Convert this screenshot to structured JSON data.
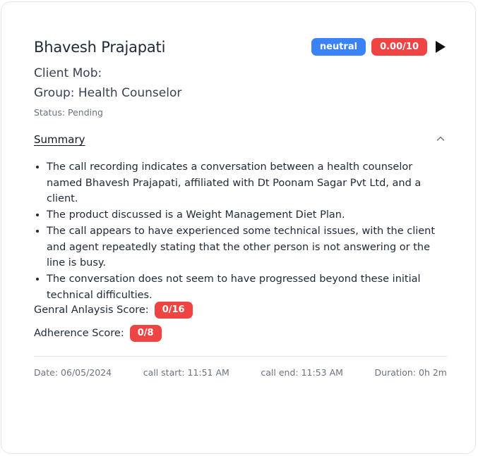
{
  "card": {
    "name": "Bhavesh Prajapati",
    "sentiment_badge": "neutral",
    "score_badge": "0.00/10",
    "play_icon": "play-icon",
    "client_mob": "Client Mob:",
    "group": "Group: Health Counselor",
    "status": "Status: Pending"
  },
  "summary": {
    "title": "Summary",
    "chevron_icon": "chevron-up-icon",
    "points": [
      "The call recording indicates a conversation between a health counselor named Bhavesh Prajapati, affiliated with Dt Poonam Sagar Pvt Ltd, and a client.",
      "The product discussed is a Weight Management Diet Plan.",
      "The call appears to have experienced some technical issues, with the client and agent repeatedly stating that the other person is not answering or the line is busy.",
      "The conversation does not seem to have progressed beyond these initial technical difficulties."
    ]
  },
  "scores": {
    "general_label": "Genral Anlaysis Score:",
    "general_value": "0/16",
    "adherence_label": "Adherence Score:",
    "adherence_value": "0/8"
  },
  "footer": {
    "date": "Date: 06/05/2024",
    "call_start": "call start: 11:51 AM",
    "call_end": "call end: 11:53 AM",
    "duration": "Duration: 0h 2m"
  },
  "colors": {
    "blue_badge": "#3b82f6",
    "red_badge": "#ef4444",
    "muted_text": "#6b7280",
    "border": "#e5e7eb"
  }
}
